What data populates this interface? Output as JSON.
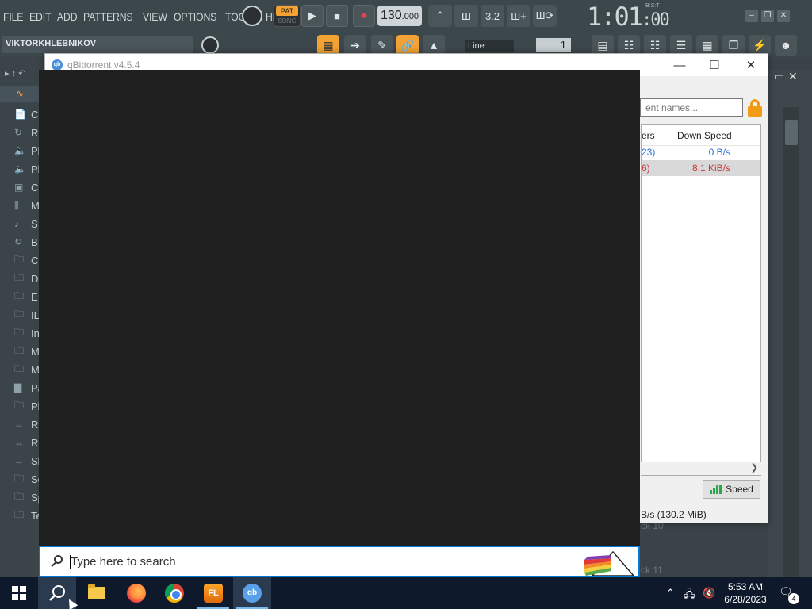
{
  "fl": {
    "menu": [
      "FILE",
      "EDIT",
      "ADD",
      "PATTERNS",
      "VIEW",
      "OPTIONS",
      "TOOLS",
      "HELP"
    ],
    "pat_label": "PAT",
    "song_label": "SONG",
    "tempo_main": "130",
    "tempo_frac": ".000",
    "time": "1:01",
    "time_small": ":00",
    "time_unit": "B:S:T",
    "hint": "VIKTORKHLEBNIKOV",
    "snap": "Line",
    "step": "1",
    "browser_items": [
      {
        "icon": "doc",
        "text": "C"
      },
      {
        "icon": "loop",
        "text": "R"
      },
      {
        "icon": "speaker",
        "text": "Pl"
      },
      {
        "icon": "speaker",
        "text": "Pl"
      },
      {
        "icon": "box",
        "text": "C"
      },
      {
        "icon": "mixer",
        "text": "M"
      },
      {
        "icon": "note",
        "text": "S"
      },
      {
        "icon": "loop",
        "text": "B"
      },
      {
        "icon": "folder",
        "text": "C"
      },
      {
        "icon": "folder",
        "text": "D"
      },
      {
        "icon": "folder",
        "text": "E"
      },
      {
        "icon": "folder",
        "text": "IL"
      },
      {
        "icon": "folder",
        "text": "In"
      },
      {
        "icon": "folder",
        "text": "M"
      },
      {
        "icon": "folder",
        "text": "M"
      },
      {
        "icon": "chart",
        "text": "Pa"
      },
      {
        "icon": "folder",
        "text": "Pl"
      },
      {
        "icon": "plug",
        "text": "R"
      },
      {
        "icon": "plug",
        "text": "R"
      },
      {
        "icon": "plug",
        "text": "Sl"
      },
      {
        "icon": "folder",
        "text": "Sc"
      },
      {
        "icon": "folder",
        "text": "Sp"
      },
      {
        "icon": "folder",
        "text": "Te"
      }
    ],
    "playlist_labels": [
      "ck 10",
      "ck 11"
    ]
  },
  "qbittorrent": {
    "title": "qBittorrent v4.5.4",
    "search_placeholder": "ent names...",
    "columns": {
      "peers": "ers",
      "down_speed": "Down Speed"
    },
    "rows": [
      {
        "peers": "23)",
        "down_speed": "0 B/s",
        "status": "idle"
      },
      {
        "peers": "6)",
        "down_speed": "8.1 KiB/s",
        "status": "downloading"
      }
    ],
    "speed_button": "Speed",
    "status_text": "B/s (130.2 MiB)"
  },
  "search": {
    "placeholder": "Type here to search"
  },
  "taskbar": {
    "apps": [
      "start",
      "search",
      "file-explorer",
      "firefox",
      "chrome",
      "fl-studio",
      "qbittorrent"
    ],
    "time": "5:53 AM",
    "date": "6/28/2023",
    "notification_count": "4"
  },
  "colors": {
    "fl_bg": "#3c474c",
    "fl_accent": "#f3a233",
    "panel_black": "#1f1f1f",
    "taskbar": "#0e1a2b",
    "qb_blue": "#2a6fd8",
    "qb_red": "#c43a3a"
  }
}
